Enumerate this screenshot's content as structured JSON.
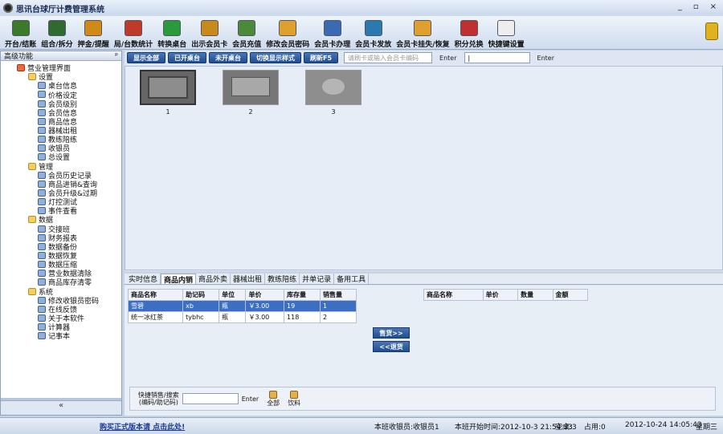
{
  "window": {
    "title": "思讯台球厅计费管理系统",
    "min": "_",
    "restore": "▫",
    "close": "×"
  },
  "toolbar": {
    "items": [
      {
        "label": "开台/结账",
        "icon": "open-table-icon",
        "color": "#3a7a2a"
      },
      {
        "label": "组合/拆分",
        "icon": "combine-icon",
        "color": "#2f6a2f"
      },
      {
        "label": "押金/提醒",
        "icon": "deposit-icon",
        "color": "#d08a1a"
      },
      {
        "label": "局/台数统计",
        "icon": "stats-icon",
        "color": "#c03a2a"
      },
      {
        "label": "转换桌台",
        "icon": "transfer-icon",
        "color": "#2a9a3a"
      },
      {
        "label": "出示会员卡",
        "icon": "show-card-icon",
        "color": "#c88a1a"
      },
      {
        "label": "会员充值",
        "icon": "recharge-icon",
        "color": "#4a8a3a"
      },
      {
        "label": "修改会员密码",
        "icon": "key-icon",
        "color": "#e0a030"
      },
      {
        "label": "会员卡办理",
        "icon": "card-apply-icon",
        "color": "#3a6ab0"
      },
      {
        "label": "会员卡发放",
        "icon": "card-issue-icon",
        "color": "#2a7ab0"
      },
      {
        "label": "会员卡挂失/恢复",
        "icon": "card-lost-icon",
        "color": "#e0a030"
      },
      {
        "label": "积分兑换",
        "icon": "gift-icon",
        "color": "#c03030"
      },
      {
        "label": "快捷键设置",
        "icon": "hotkey-icon",
        "color": "#eeeeee"
      }
    ]
  },
  "sidebar": {
    "title": "高级功能",
    "pin": "ᵖ",
    "collapse": "«",
    "tree": [
      {
        "label": "营业管理界面",
        "level": 0,
        "kind": "home"
      },
      {
        "label": "设置",
        "level": 1,
        "kind": "folder"
      },
      {
        "label": "桌台信息",
        "level": 2,
        "kind": "leaf"
      },
      {
        "label": "价格设定",
        "level": 2,
        "kind": "leaf"
      },
      {
        "label": "会员级别",
        "level": 2,
        "kind": "leaf"
      },
      {
        "label": "会员信息",
        "level": 2,
        "kind": "leaf"
      },
      {
        "label": "商品信息",
        "level": 2,
        "kind": "leaf"
      },
      {
        "label": "器械出租",
        "level": 2,
        "kind": "leaf"
      },
      {
        "label": "教练陪练",
        "level": 2,
        "kind": "leaf"
      },
      {
        "label": "收银员",
        "level": 2,
        "kind": "leaf"
      },
      {
        "label": "总设置",
        "level": 2,
        "kind": "leaf"
      },
      {
        "label": "管理",
        "level": 1,
        "kind": "folder"
      },
      {
        "label": "会员历史记录",
        "level": 2,
        "kind": "leaf"
      },
      {
        "label": "商品进销&查询",
        "level": 2,
        "kind": "leaf"
      },
      {
        "label": "会员升级&过期",
        "level": 2,
        "kind": "leaf"
      },
      {
        "label": "灯控测试",
        "level": 2,
        "kind": "leaf"
      },
      {
        "label": "事件查看",
        "level": 2,
        "kind": "leaf"
      },
      {
        "label": "数据",
        "level": 1,
        "kind": "folder"
      },
      {
        "label": "交接班",
        "level": 2,
        "kind": "leaf"
      },
      {
        "label": "财务报表",
        "level": 2,
        "kind": "leaf"
      },
      {
        "label": "数据备份",
        "level": 2,
        "kind": "leaf"
      },
      {
        "label": "数据恢复",
        "level": 2,
        "kind": "leaf"
      },
      {
        "label": "数据压缩",
        "level": 2,
        "kind": "leaf"
      },
      {
        "label": "营业数据清除",
        "level": 2,
        "kind": "leaf"
      },
      {
        "label": "商品库存清零",
        "level": 2,
        "kind": "leaf"
      },
      {
        "label": "系统",
        "level": 1,
        "kind": "folder"
      },
      {
        "label": "修改收银员密码",
        "level": 2,
        "kind": "leaf"
      },
      {
        "label": "在线反馈",
        "level": 2,
        "kind": "leaf"
      },
      {
        "label": "关于本软件",
        "level": 2,
        "kind": "leaf"
      },
      {
        "label": "计算器",
        "level": 2,
        "kind": "leaf"
      },
      {
        "label": "记事本",
        "level": 2,
        "kind": "leaf"
      }
    ]
  },
  "filterbar": {
    "buttons": [
      "显示全部",
      "已开桌台",
      "未开桌台",
      "切换显示样式",
      "刷新F5"
    ],
    "card_placeholder": "请刷卡或输入会员卡编码",
    "enter_label_1": "Enter",
    "enter_label_2": "Enter"
  },
  "tables": [
    {
      "num": "1",
      "kind": "pool"
    },
    {
      "num": "2",
      "kind": "pingpong"
    },
    {
      "num": "3",
      "kind": "tea"
    }
  ],
  "tabs": [
    "实时信息",
    "商品内销",
    "商品外卖",
    "器械出租",
    "教练陪练",
    "并单记录",
    "备用工具"
  ],
  "active_tab": 1,
  "goods": {
    "headers": [
      "商品名称",
      "助记码",
      "单位",
      "单价",
      "库存量",
      "销售量"
    ],
    "rows": [
      [
        "雪碧",
        "xb",
        "瓶",
        "￥3.00",
        "19",
        "1"
      ],
      [
        "统一冰红茶",
        "tybhc",
        "瓶",
        "￥3.00",
        "118",
        "2"
      ]
    ]
  },
  "cart": {
    "headers": [
      "商品名称",
      "单价",
      "数量",
      "金额"
    ]
  },
  "actions": {
    "sell": "售货>>",
    "return": "<<退货"
  },
  "quick": {
    "label_1": "快捷销售/搜索",
    "label_2": "(编码/助记码)",
    "enter": "Enter",
    "all": "全部",
    "drinks": "饮料"
  },
  "status": {
    "buy": "购买正式版本请 点击此处!",
    "cashier": "本班收银员:收银员1",
    "shift_start": "本班开始时间:2012-10-3 21:54:33",
    "free": "空桌:3",
    "used": "占用:0",
    "datetime": "2012-10-24 14:05:43",
    "weekday": "星期三"
  }
}
